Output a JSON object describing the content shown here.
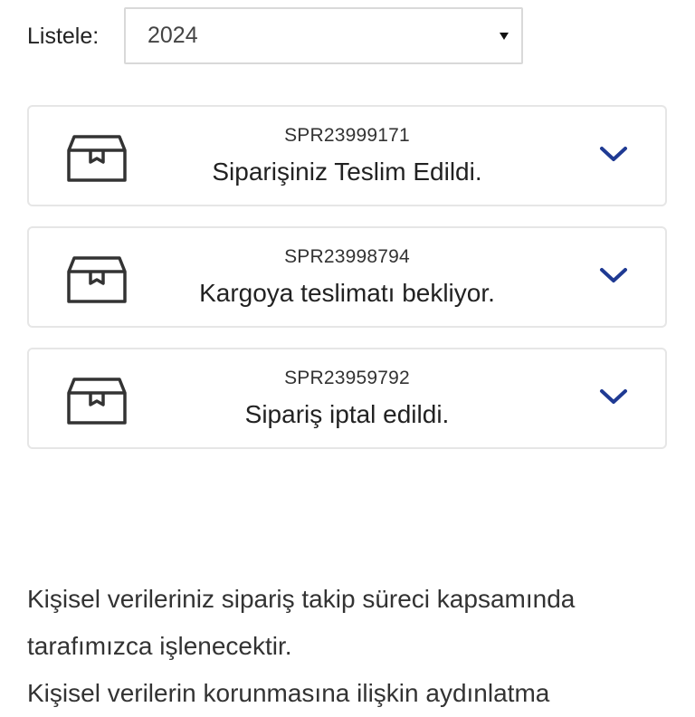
{
  "filter": {
    "label": "Listele:",
    "selected_value": "2024"
  },
  "orders": [
    {
      "id": "SPR23999171",
      "status": "Siparişiniz Teslim Edildi.",
      "icon": "package-box-icon"
    },
    {
      "id": "SPR23998794",
      "status": "Kargoya teslimatı bekliyor.",
      "icon": "package-box-icon"
    },
    {
      "id": "SPR23959792",
      "status": "Sipariş iptal edildi.",
      "icon": "package-box-icon"
    }
  ],
  "privacy": {
    "line1": "Kişisel verileriniz sipariş takip süreci kapsamında tarafımızca işlenecektir.",
    "line2": "Kişisel verilerin korunmasına ilişkin aydınlatma"
  },
  "colors": {
    "accent": "#1f3a93",
    "border": "#e6e6e6",
    "icon": "#333333"
  }
}
